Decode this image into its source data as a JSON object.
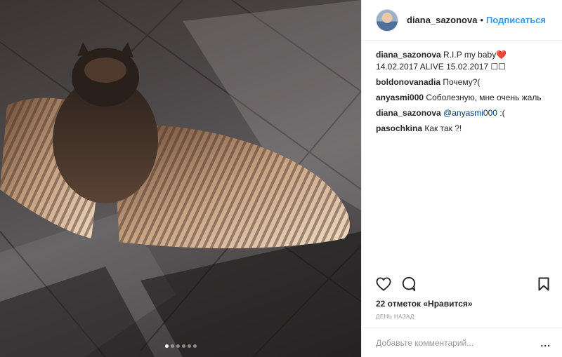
{
  "post": {
    "image_alt": "owl with spread wings on tiled floor",
    "carousel": {
      "count": 6,
      "active_index": 0
    }
  },
  "header": {
    "username": "diana_sazonova",
    "separator": "•",
    "follow_label": "Подписаться"
  },
  "comments": [
    {
      "user": "diana_sazonova",
      "text": "R.I.P my baby❤️14.02.2017 ALIVE 15.02.2017 ☐☐",
      "mention": ""
    },
    {
      "user": "boldonovanadia",
      "text": "Почему?(",
      "mention": ""
    },
    {
      "user": "anyasmi000",
      "text": "Соболезную, мне очень жаль",
      "mention": ""
    },
    {
      "user": "diana_sazonova",
      "text": " :(",
      "mention": "@anyasmi000"
    },
    {
      "user": "pasochkina",
      "text": "Как так ?!",
      "mention": ""
    }
  ],
  "actions": {
    "like_icon": "heart-icon",
    "comment_icon": "comment-icon",
    "save_icon": "bookmark-icon"
  },
  "likes_text": "22 отметок «Нравится»",
  "time_text": "ДЕНЬ НАЗАД",
  "add_comment": {
    "placeholder": "Добавьте комментарий...",
    "more_label": "..."
  },
  "colors": {
    "accent": "#3897f0",
    "text": "#262626",
    "muted": "#999999"
  }
}
